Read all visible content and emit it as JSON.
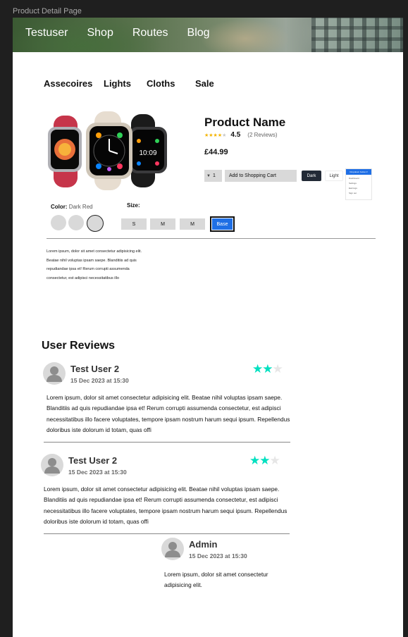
{
  "frame_title": "Product Detail Page",
  "nav": [
    "Testuser",
    "Shop",
    "Routes",
    "Blog"
  ],
  "categories": [
    "Assecoires",
    "Lights",
    "Cloths",
    "Sale"
  ],
  "product": {
    "name": "Product Name",
    "rating": "4.5",
    "rating_stars": 4.5,
    "review_count": "(2 Reviews)",
    "price": "£44.99",
    "quantity": "1",
    "add_to_cart": "Add to Shopping Cart",
    "dark_label": "Dark",
    "light_label": "Light",
    "dropdown": {
      "button": "Dropdown button",
      "items": [
        "Dashboard",
        "Settings",
        "Earnings",
        "Sign out"
      ]
    },
    "color_label": "Color:",
    "color_value": "Dark Red",
    "swatches": [
      "swatch-1",
      "swatch-2",
      "swatch-3"
    ],
    "selected_swatch": 2,
    "size_label": "Size:",
    "sizes": [
      "S",
      "M",
      "M",
      "Base"
    ],
    "selected_size": 3,
    "description": "Lorem ipsum, dolor sit amet consectetur adipisicing elit. Beatae nihil voluptas ipsam saepe. Blanditiis ad quis repudiandae ipsa et! Rerum corrupti assumenda consectetur, est adipisci necessitatibus illo"
  },
  "reviews_title": "User Reviews",
  "reviews": [
    {
      "name": "Test User 2",
      "date": "15 Dec 2023 at 15:30",
      "stars": 2,
      "max_stars": 3,
      "text": "Lorem ipsum, dolor sit amet consectetur adipisicing elit. Beatae nihil voluptas ipsam saepe. Blanditiis ad quis repudiandae ipsa et! Rerum corrupti assumenda consectetur, est adipisci necessitatibus illo facere voluptates, tempore ipsam nostrum harum sequi ipsum. Repellendus doloribus iste dolorum id totam, quas offi"
    },
    {
      "name": "Test User 2",
      "date": "15 Dec 2023 at 15:30",
      "stars": 2,
      "max_stars": 3,
      "text": "Lorem ipsum, dolor sit amet consectetur adipisicing elit. Beatae nihil voluptas ipsam saepe. Blanditiis ad quis repudiandae ipsa et! Rerum corrupti assumenda consectetur, est adipisci necessitatibus illo facere voluptates, tempore ipsam nostrum harum sequi ipsum. Repellendus doloribus iste dolorum id totam, quas offi"
    }
  ],
  "admin_reply": {
    "name": "Admin",
    "date": "15 Dec 2023 at 15:30",
    "text": "Lorem ipsum, dolor sit amet consectetur adipisicing elit."
  },
  "colors": {
    "accent_blue": "#1f6fe5",
    "star_teal": "#00e0c0",
    "star_gold": "#f4b400",
    "dark_button": "#222a36",
    "placeholder_gray": "#d9d9d9"
  }
}
